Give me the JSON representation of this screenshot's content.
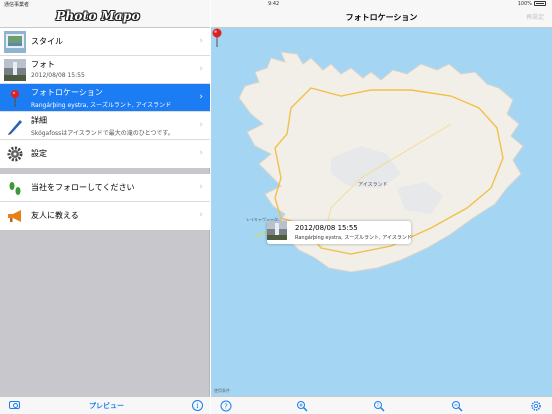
{
  "status_bar": {
    "carrier": "通信事業者 ",
    "time": "9:42",
    "battery": "100%"
  },
  "master": {
    "logo": "Photo Mapo",
    "menu": [
      {
        "title": "スタイル",
        "subtitle": "",
        "icon": "style-thumbnail"
      },
      {
        "title": "フォト",
        "subtitle": "2012/08/08 15:55",
        "icon": "photo-thumbnail"
      },
      {
        "title": "フォトロケーション",
        "subtitle": "Rangárþing eystra, スーズルラント, アイスランド",
        "icon": "red-pin-icon",
        "selected": true
      },
      {
        "title": "詳細",
        "subtitle": "Skógafossはアイスランドで最大の滝のひとつです。",
        "icon": "pen-icon"
      },
      {
        "title": "設定",
        "subtitle": "",
        "icon": "gear-icon"
      }
    ],
    "social": [
      {
        "title": "当社をフォローしてください",
        "icon": "footprints-icon"
      },
      {
        "title": "友人に教える",
        "icon": "megaphone-icon"
      }
    ],
    "toolbar": {
      "preview_label": "プレビュー",
      "info_label": "i"
    }
  },
  "detail": {
    "title": "フォトロケーション",
    "relocate_label": "再設定",
    "map": {
      "country_label": "アイスランド",
      "city_label": "レイキャヴィーク",
      "legal_label": "使用条件"
    },
    "callout": {
      "date": "2012/08/08 15:55",
      "location": "Rangárþing eystra, スーズルラント, アイスランド"
    }
  },
  "colors": {
    "accent": "#1c7cf4",
    "sea": "#a4d6f4",
    "land": "#f2efe9",
    "road": "#f2c04a",
    "pin": "#e02020"
  }
}
